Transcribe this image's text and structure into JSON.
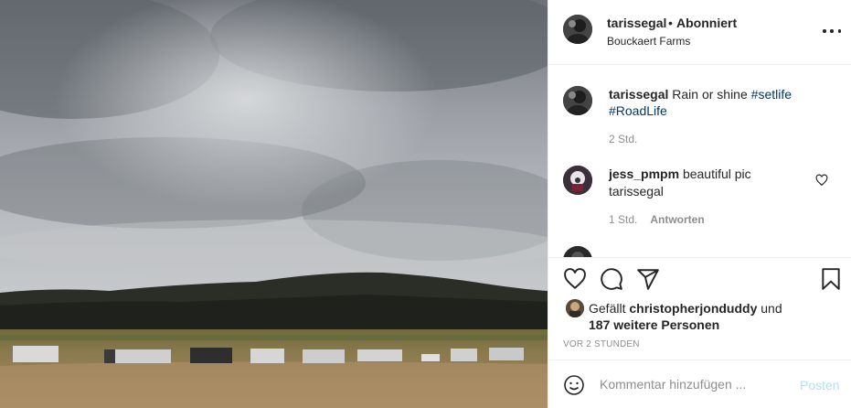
{
  "post": {
    "username": "tarissegal",
    "separator": "•",
    "follow_status": "Abonniert",
    "location": "Bouckaert Farms"
  },
  "caption": {
    "username": "tarissegal",
    "text": "Rain or shine",
    "hashtags": [
      "#setlife",
      "#RoadLife"
    ],
    "time": "2 Std."
  },
  "comments": [
    {
      "username": "jess_pmpm",
      "text": "beautiful pic",
      "mention": "tarissegal",
      "time": "1 Std.",
      "reply_label": "Antworten"
    }
  ],
  "likes": {
    "prefix": "Gefällt",
    "user": "christopherjonduddy",
    "connector": "und",
    "others": "187 weitere Personen"
  },
  "posted_ago": "VOR 2 STUNDEN",
  "comment_box": {
    "placeholder": "Kommentar hinzufügen ...",
    "post_label": "Posten"
  },
  "icons": {
    "more": "more-options-icon",
    "like": "heart-icon",
    "comment": "comment-icon",
    "share": "share-icon",
    "save": "bookmark-icon",
    "emoji": "emoji-icon"
  },
  "colors": {
    "link": "#00376b",
    "muted": "#8e8e8e",
    "post_button_disabled": "#b2dffc",
    "text": "#262626"
  }
}
